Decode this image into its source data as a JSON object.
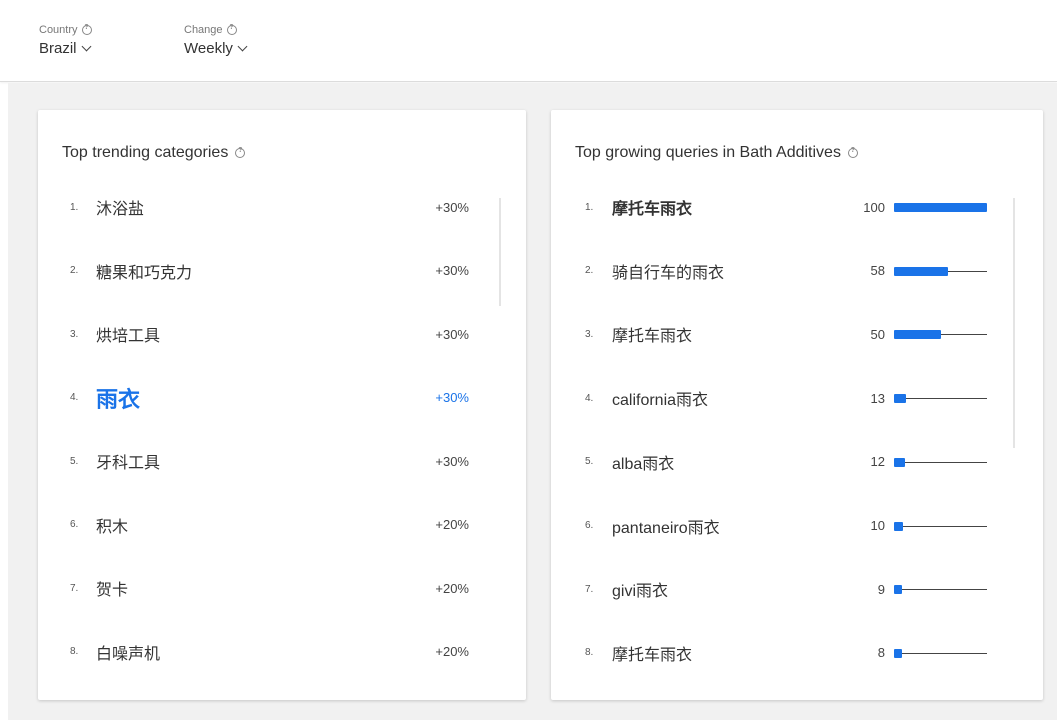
{
  "filters": {
    "country": {
      "label": "Country",
      "value": "Brazil"
    },
    "change": {
      "label": "Change",
      "value": "Weekly"
    }
  },
  "categories_card": {
    "title": "Top trending categories",
    "items": [
      {
        "rank": "1.",
        "name": "沐浴盐",
        "change": "+30%"
      },
      {
        "rank": "2.",
        "name": "糖果和巧克力",
        "change": "+30%"
      },
      {
        "rank": "3.",
        "name": "烘培工具",
        "change": "+30%"
      },
      {
        "rank": "4.",
        "name": "雨衣",
        "change": "+30%",
        "selected": true
      },
      {
        "rank": "5.",
        "name": "牙科工具",
        "change": "+30%"
      },
      {
        "rank": "6.",
        "name": "积木",
        "change": "+20%"
      },
      {
        "rank": "7.",
        "name": "贺卡",
        "change": "+20%"
      },
      {
        "rank": "8.",
        "name": "白噪声机",
        "change": "+20%"
      }
    ]
  },
  "queries_card": {
    "title": "Top growing queries in Bath Additives",
    "items": [
      {
        "rank": "1.",
        "name": "摩托车雨衣",
        "value": 100
      },
      {
        "rank": "2.",
        "name": "骑自行车的雨衣",
        "value": 58
      },
      {
        "rank": "3.",
        "name": "摩托车雨衣",
        "value": 50
      },
      {
        "rank": "4.",
        "name": "california雨衣",
        "value": 13
      },
      {
        "rank": "5.",
        "name": "alba雨衣",
        "value": 12
      },
      {
        "rank": "6.",
        "name": "pantaneiro雨衣",
        "value": 10
      },
      {
        "rank": "7.",
        "name": "givi雨衣",
        "value": 9
      },
      {
        "rank": "8.",
        "name": "摩托车雨衣",
        "value": 8
      }
    ]
  },
  "colors": {
    "accent": "#1a73e8"
  }
}
